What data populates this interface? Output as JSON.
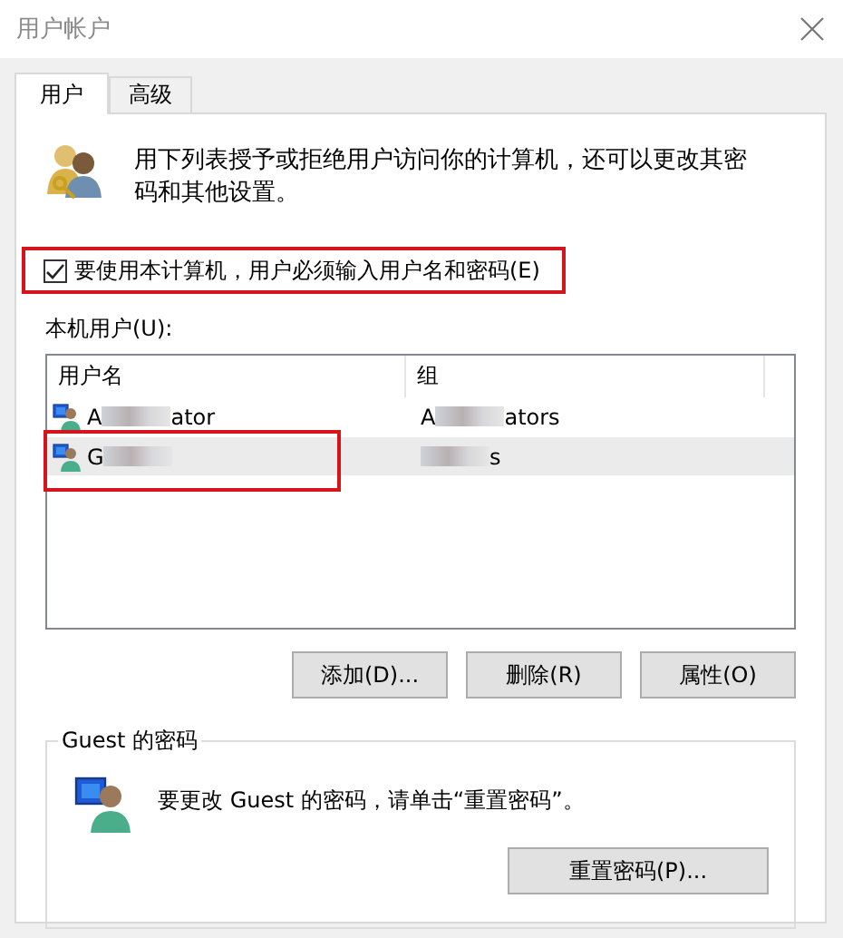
{
  "window": {
    "title": "用户帐户"
  },
  "tabs": [
    {
      "label": "用户",
      "selected": true
    },
    {
      "label": "高级",
      "selected": false
    }
  ],
  "intro": "用下列表授予或拒绝用户访问你的计算机，还可以更改其密码和其他设置。",
  "require_login": {
    "label": "要使用本计算机，用户必须输入用户名和密码(E)",
    "checked": true,
    "highlighted": true
  },
  "users_label": "本机用户(U):",
  "user_list": {
    "columns": [
      "用户名",
      "组"
    ],
    "rows": [
      {
        "selected": false,
        "highlighted": false,
        "name": [
          {
            "kind": "text",
            "text": "A"
          },
          {
            "kind": "blur"
          },
          {
            "kind": "text",
            "text": "ator"
          }
        ],
        "group": [
          {
            "kind": "text",
            "text": "A"
          },
          {
            "kind": "blur"
          },
          {
            "kind": "text",
            "text": "ators"
          }
        ]
      },
      {
        "selected": true,
        "highlighted": true,
        "name": [
          {
            "kind": "text",
            "text": "G"
          },
          {
            "kind": "blur"
          }
        ],
        "group": [
          {
            "kind": "blur"
          },
          {
            "kind": "text",
            "text": "s"
          }
        ]
      }
    ]
  },
  "user_buttons": [
    "添加(D)...",
    "删除(R)",
    "属性(O)"
  ],
  "password_group": {
    "title": "Guest 的密码",
    "message": "要更改 Guest 的密码，请单击“重置密码”。",
    "button": "重置密码(P)..."
  }
}
